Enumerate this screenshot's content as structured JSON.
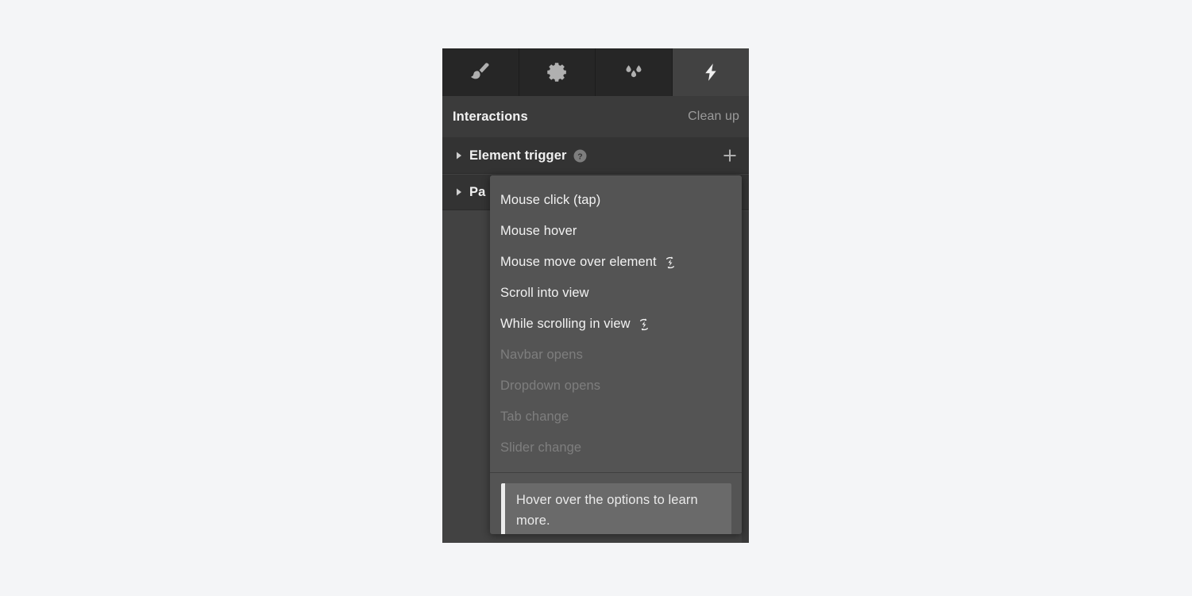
{
  "panel": {
    "tabs": [
      {
        "name": "style",
        "icon": "paintbrush-icon",
        "active": false
      },
      {
        "name": "settings",
        "icon": "gear-icon",
        "active": false
      },
      {
        "name": "style-manager",
        "icon": "droplets-icon",
        "active": false
      },
      {
        "name": "interactions",
        "icon": "lightning-bolt-icon",
        "active": true
      }
    ],
    "header": {
      "title": "Interactions",
      "cleanup_label": "Clean up"
    },
    "sections": [
      {
        "label": "Element trigger",
        "help_icon": "question-mark-circle-icon",
        "add_icon": "plus-icon",
        "disclosure_icon": "chevron-right-icon"
      },
      {
        "label": "Pa",
        "disclosure_icon": "chevron-right-icon"
      }
    ]
  },
  "dropdown": {
    "items": [
      {
        "label": "Mouse click (tap)",
        "disabled": false,
        "icon": null
      },
      {
        "label": "Mouse hover",
        "disabled": false,
        "icon": null
      },
      {
        "label": "Mouse move over element",
        "disabled": false,
        "icon": "loop-lightning-icon"
      },
      {
        "label": "Scroll into view",
        "disabled": false,
        "icon": null
      },
      {
        "label": "While scrolling in view",
        "disabled": false,
        "icon": "loop-lightning-icon"
      },
      {
        "label": "Navbar opens",
        "disabled": true,
        "icon": null
      },
      {
        "label": "Dropdown opens",
        "disabled": true,
        "icon": null
      },
      {
        "label": "Tab change",
        "disabled": true,
        "icon": null
      },
      {
        "label": "Slider change",
        "disabled": true,
        "icon": null
      }
    ],
    "tooltip": {
      "text": "Hover over the options to learn more."
    }
  },
  "colors": {
    "page_background": "#f4f5f7",
    "panel_background": "#424242",
    "tabbar_background": "#262626",
    "section_row_background": "#333333",
    "dropdown_background": "#545454",
    "tooltip_background": "#6a6a6a",
    "tooltip_accent": "#ededed",
    "text_primary": "#f2f2f2",
    "text_muted": "#9b9b9b",
    "text_disabled": "#7e7e7e"
  }
}
